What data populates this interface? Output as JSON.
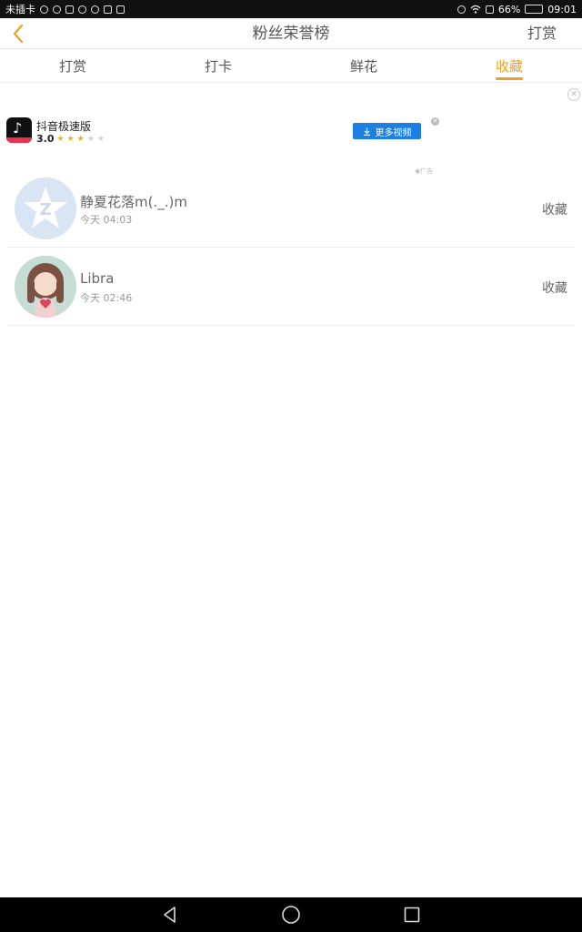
{
  "status_bar": {
    "carrier": "未插卡",
    "battery": "66%",
    "battery_level": 0.66,
    "time": "09:01"
  },
  "header": {
    "title": "粉丝荣誉榜",
    "action": "打赏",
    "back_icon": "chevron-left-icon",
    "accent": "#e9a31f"
  },
  "tabs": [
    {
      "label": "打赏",
      "active": false
    },
    {
      "label": "打卡",
      "active": false
    },
    {
      "label": "鲜花",
      "active": false
    },
    {
      "label": "收藏",
      "active": true
    }
  ],
  "ad": {
    "app_name": "抖音极速版",
    "rating": "3.0",
    "stars": 3,
    "cta": "更多视频",
    "cta_color": "#1d7fe3",
    "tag": "广告"
  },
  "list": [
    {
      "name": "静夏花落m(._.)m",
      "time": "今天 04:03",
      "action": "收藏",
      "avatar": "qq-default-avatar"
    },
    {
      "name": "Libra",
      "time": "今天 02:46",
      "action": "收藏",
      "avatar": "girl-illustration-avatar"
    }
  ]
}
